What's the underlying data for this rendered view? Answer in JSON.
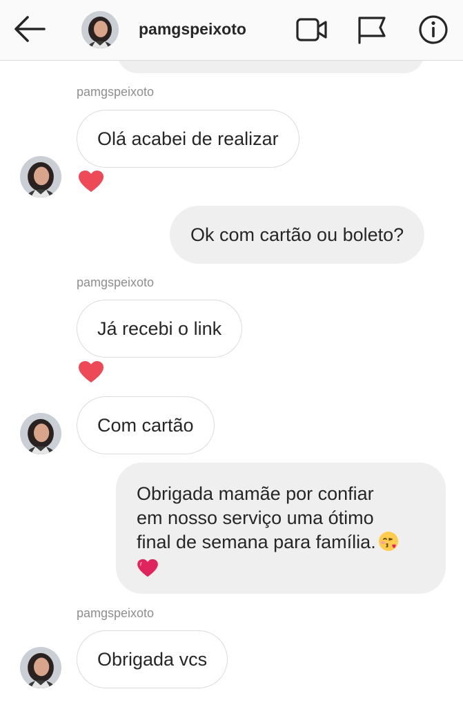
{
  "header": {
    "username": "pamgspeixoto",
    "icons": [
      "back-arrow-icon",
      "video-call-icon",
      "flag-icon",
      "info-icon"
    ]
  },
  "messages": [
    {
      "direction": "incoming",
      "sender": "pamgspeixoto",
      "text": "Olá acabei de realizar",
      "reaction": "red-heart"
    },
    {
      "direction": "outgoing",
      "text": "Ok com cartão ou boleto?"
    },
    {
      "direction": "incoming",
      "sender": "pamgspeixoto",
      "text": "Já recebi o link",
      "reaction": "red-heart"
    },
    {
      "direction": "incoming",
      "text": "Com cartão"
    },
    {
      "direction": "outgoing",
      "lines": [
        "Obrigada mamãe por confiar",
        "em nosso serviço uma ótimo",
        "final de semana para família."
      ],
      "emoji": [
        "kissing-face-emoji",
        "red-heart-emoji"
      ]
    },
    {
      "direction": "incoming",
      "sender": "pamgspeixoto",
      "text": "Obrigada vcs"
    }
  ],
  "colors": {
    "header_bg": "#fafafa",
    "outgoing_bubble": "#efefef",
    "incoming_border": "#dbdbdb",
    "sender_text": "#8e8e8e",
    "heart": "#ed4956"
  }
}
